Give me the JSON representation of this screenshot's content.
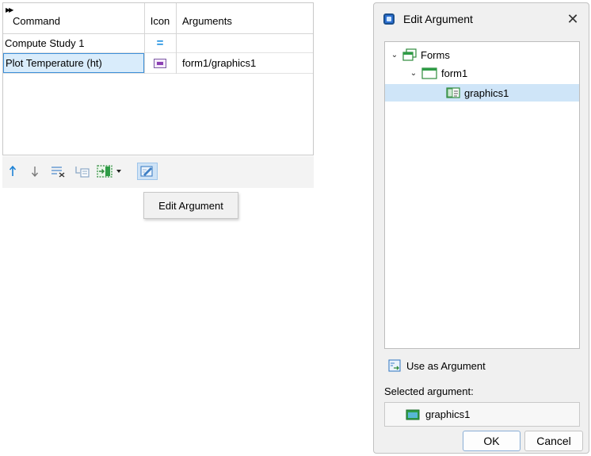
{
  "table": {
    "headers": {
      "command": "Command",
      "icon": "Icon",
      "arguments": "Arguments"
    },
    "rows": [
      {
        "command": "Compute Study 1",
        "icon": "equals-icon",
        "arguments": ""
      },
      {
        "command": "Plot Temperature (ht)",
        "icon": "plot-icon",
        "arguments": "form1/graphics1"
      }
    ]
  },
  "toolbar": {
    "items": [
      "move-up-icon",
      "move-down-icon",
      "delete-icon",
      "add-command-icon",
      "insert-icon",
      "edit-argument-icon"
    ],
    "tooltip": "Edit Argument"
  },
  "dialog": {
    "title": "Edit Argument",
    "close": "✕",
    "tree": {
      "root": "Forms",
      "child": "form1",
      "leaf": "graphics1"
    },
    "use_as_argument": "Use as Argument",
    "selected_label": "Selected argument:",
    "selected_value": "graphics1",
    "ok": "OK",
    "cancel": "Cancel"
  },
  "colors": {
    "accent": "#3c8fd8",
    "selection": "#cfe5f8"
  }
}
